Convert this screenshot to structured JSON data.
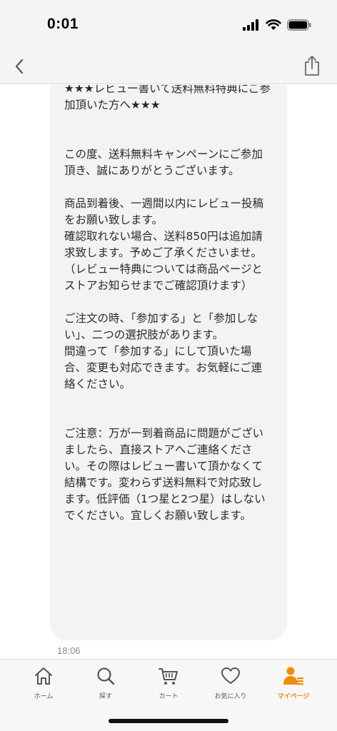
{
  "status_bar": {
    "time": "0:01"
  },
  "chat": {
    "message": "★★★レビュー書いて送料無料特典にご参加頂いた方へ★★★\n\n\nこの度、送料無料キャンペーンにご参加頂き、誠にありがとうございます。\n\n商品到着後、一週間以内にレビュー投稿をお願い致します。\n確認取れない場合、送料850円は追加請求致します。予めご了承くださいませ。\n（レビュー特典については商品ページとストアお知らせまでご確認頂けます）\n\nご注文の時、「参加する」と「参加しない」、二つの選択肢があります。\n間違って「参加する」にして頂いた場合、変更も対応できます。お気軽にご連絡ください。\n\n\nご注意：万が一到着商品に問題がございましたら、直接ストアへご連絡ください。その際はレビュー書いて頂かなくて結構です。変わらず送料無料で対応致します。低評価（1つ星と2つ星）はしないでください。宜しくお願い致します。",
    "time": "18:06"
  },
  "tabs": [
    {
      "label": "ホーム",
      "icon": "home-icon"
    },
    {
      "label": "探す",
      "icon": "search-icon"
    },
    {
      "label": "カート",
      "icon": "cart-icon"
    },
    {
      "label": "お気に入り",
      "icon": "heart-icon"
    },
    {
      "label": "マイページ",
      "icon": "person-icon"
    }
  ],
  "colors": {
    "accent": "#f08c00",
    "bubble": "#f3f3f3",
    "bar": "#f4f4f4"
  }
}
